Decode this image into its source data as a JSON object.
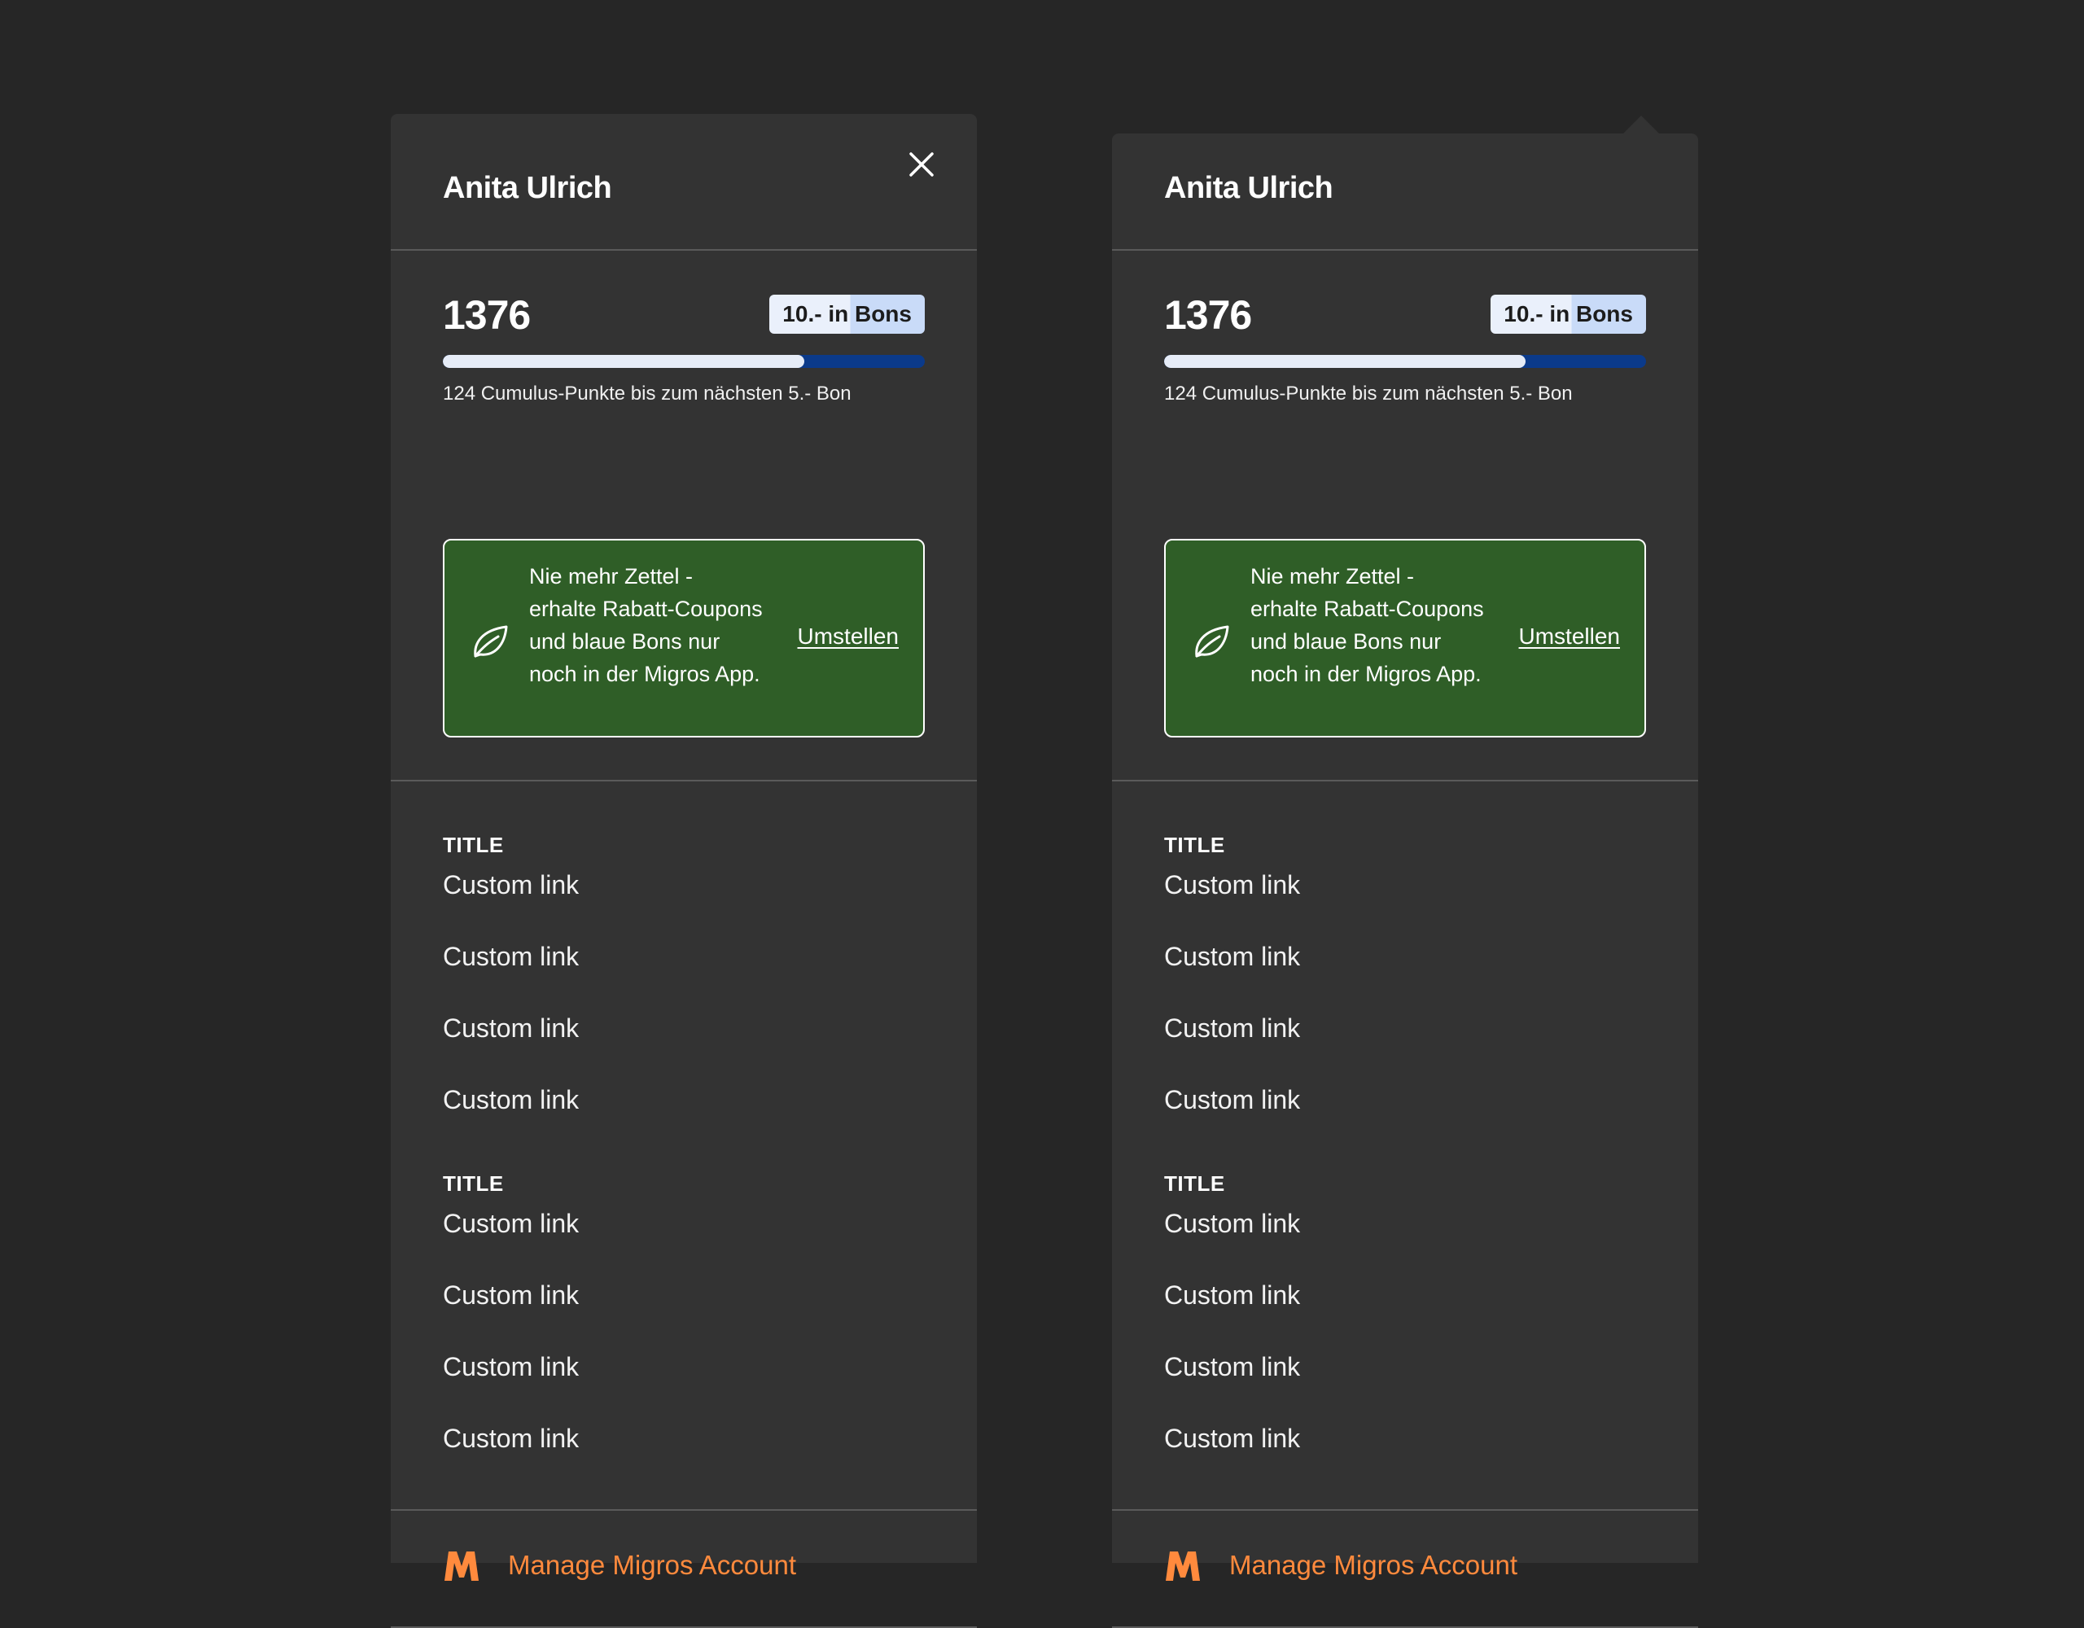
{
  "colors": {
    "background": "#262626",
    "panel": "#333333",
    "divider": "#5a5a5a",
    "eco_green": "#2f5e27",
    "progress_track": "#0b3a8a",
    "progress_fill": "#e6ecf7",
    "accent_orange": "#ff8a3d"
  },
  "panels": [
    {
      "variant": "overlay",
      "user_name": "Anita Ulrich",
      "close_icon": "close-icon",
      "points": "1376",
      "bons_badge": "10.- in Bons",
      "progress": 0.75,
      "points_caption": "124 Cumulus-Punkte bis zum nächsten 5.- Bon",
      "eco_banner": {
        "icon": "leaf-icon",
        "text": "Nie mehr Zettel - erhalte Rabatt-Coupons und blaue Bons nur noch in der Migros App.",
        "link": "Umstellen"
      },
      "groups": [
        {
          "title": "TITLE",
          "links": [
            "Custom link",
            "Custom link",
            "Custom link",
            "Custom link"
          ]
        },
        {
          "title": "TITLE",
          "links": [
            "Custom link",
            "Custom link",
            "Custom link",
            "Custom link"
          ]
        }
      ],
      "account": {
        "icon": "migros-m-icon",
        "label": "Manage Migros Account"
      }
    },
    {
      "variant": "dropdown",
      "user_name": "Anita Ulrich",
      "points": "1376",
      "bons_badge": "10.- in Bons",
      "progress": 0.75,
      "points_caption": "124 Cumulus-Punkte bis zum nächsten 5.- Bon",
      "eco_banner": {
        "icon": "leaf-icon",
        "text": "Nie mehr Zettel - erhalte Rabatt-Coupons und blaue Bons nur noch in der Migros App.",
        "link": "Umstellen"
      },
      "groups": [
        {
          "title": "TITLE",
          "links": [
            "Custom link",
            "Custom link",
            "Custom link",
            "Custom link"
          ]
        },
        {
          "title": "TITLE",
          "links": [
            "Custom link",
            "Custom link",
            "Custom link",
            "Custom link"
          ]
        }
      ],
      "account": {
        "icon": "migros-m-icon",
        "label": "Manage Migros Account"
      }
    }
  ]
}
